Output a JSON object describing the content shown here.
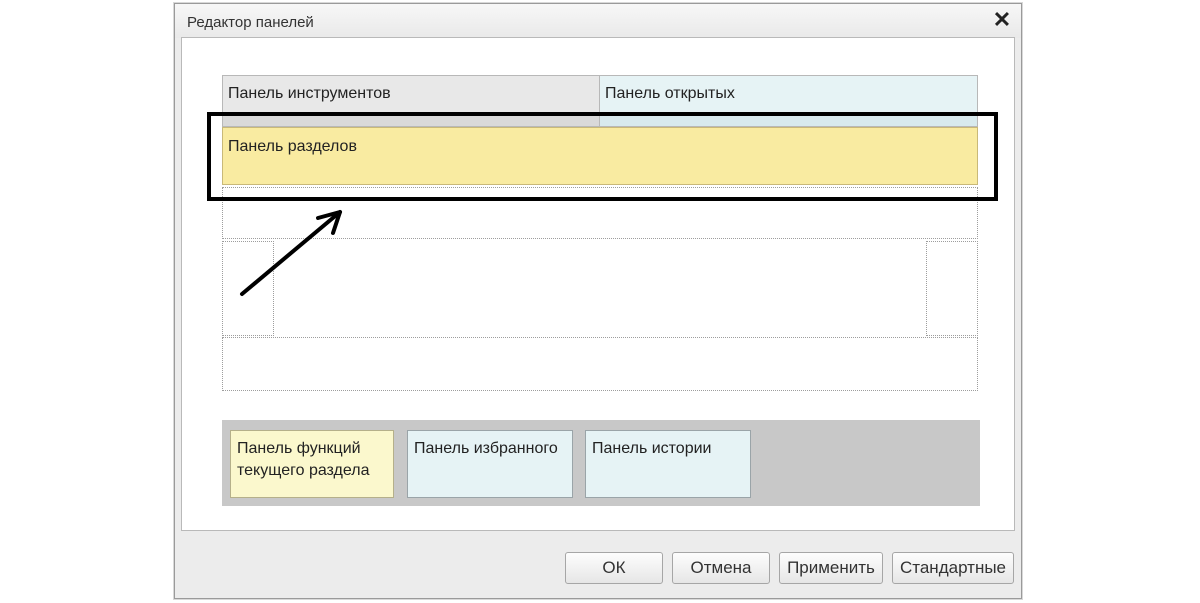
{
  "window": {
    "title": "Редактор панелей"
  },
  "layout": {
    "panels": {
      "tools": "Панель инструментов",
      "open": "Панель открытых",
      "sections": "Панель разделов"
    }
  },
  "available_panels": [
    "Панель функций текущего раздела",
    "Панель избранного",
    "Панель истории"
  ],
  "buttons": {
    "ok": "ОК",
    "cancel": "Отмена",
    "apply": "Применить",
    "default": "Стандартные"
  },
  "icons": {
    "close": "close-icon",
    "arrow": "arrow-annotation"
  },
  "colors": {
    "sections_panel": "#f9eba1",
    "function_panel": "#fbf8cd",
    "light_blue_panel": "#e6f3f5",
    "tools_panel": "#e8e8e8",
    "available_area": "#c8c8c8",
    "highlight": "#000000"
  }
}
